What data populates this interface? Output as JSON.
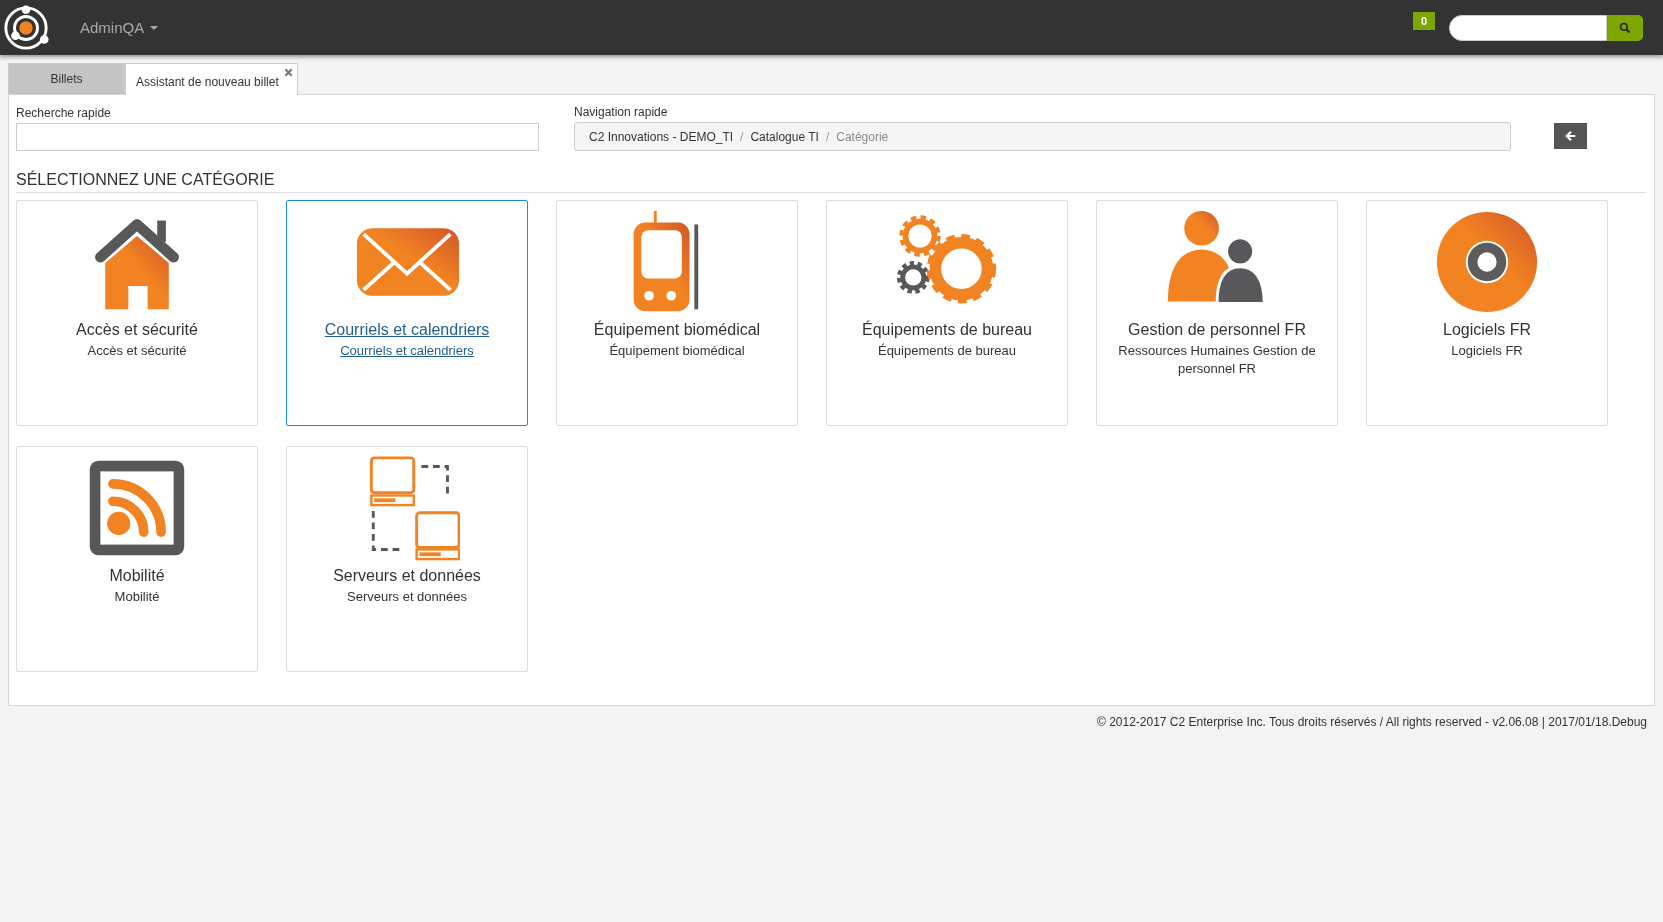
{
  "header": {
    "user_menu": "AdminQA",
    "badge": "0"
  },
  "tabs": [
    {
      "label": "Billets",
      "selected": false,
      "closable": false
    },
    {
      "label": "Assistant de nouveau billet",
      "selected": true,
      "closable": true
    }
  ],
  "quick_search": {
    "label": "Recherche rapide"
  },
  "quick_nav": {
    "label": "Navigation rapide",
    "separator": "/",
    "breadcrumb": [
      {
        "label": "C2 Innovations - DEMO_TI",
        "current": false
      },
      {
        "label": "Catalogue TI",
        "current": false
      },
      {
        "label": "Catégorie",
        "current": true
      }
    ]
  },
  "section_title": "SÉLECTIONNEZ UNE CATÉGORIE",
  "categories": [
    {
      "kind": "house",
      "title": "Accès et sécurité",
      "subtitle": "Accès et sécurité",
      "selected": false
    },
    {
      "kind": "envelope",
      "title": "Courriels et calendriers",
      "subtitle": "Courriels et calendriers",
      "selected": true
    },
    {
      "kind": "device",
      "title": "Équipement biomédical",
      "subtitle": "Équipement biomédical",
      "selected": false
    },
    {
      "kind": "gears",
      "title": "Équipements de bureau",
      "subtitle": "Équipements de bureau",
      "selected": false
    },
    {
      "kind": "people",
      "title": "Gestion de personnel FR",
      "subtitle": "Ressources Humaines Gestion de personnel FR",
      "selected": false
    },
    {
      "kind": "disc",
      "title": "Logiciels FR",
      "subtitle": "Logiciels FR",
      "selected": false
    },
    {
      "kind": "feed",
      "title": "Mobilité",
      "subtitle": "Mobilité",
      "selected": false
    },
    {
      "kind": "servers",
      "title": "Serveurs et données",
      "subtitle": "Serveurs et données",
      "selected": false
    }
  ],
  "footer": "© 2012-2017 C2 Enterprise Inc. Tous droits réservés / All rights reserved - v2.06.08 | 2017/01/18.Debug"
}
